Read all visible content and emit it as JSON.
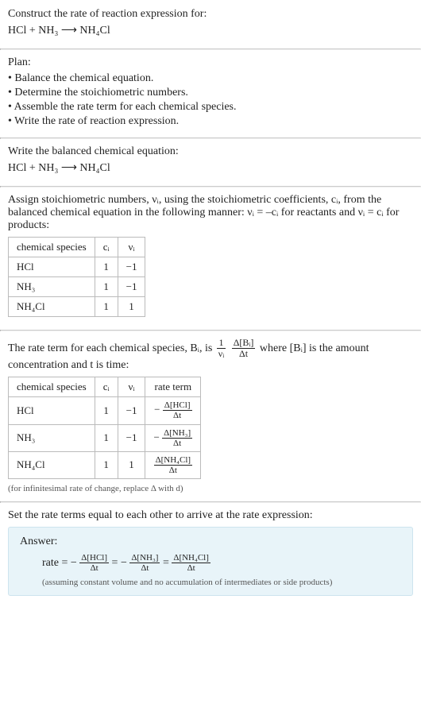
{
  "header": {
    "prompt": "Construct the rate of reaction expression for:",
    "equation": "HCl + NH₃ ⟶ NH₄Cl"
  },
  "plan": {
    "title": "Plan:",
    "items": [
      "• Balance the chemical equation.",
      "• Determine the stoichiometric numbers.",
      "• Assemble the rate term for each chemical species.",
      "• Write the rate of reaction expression."
    ]
  },
  "balanced": {
    "title": "Write the balanced chemical equation:",
    "equation": "HCl + NH₃ ⟶ NH₄Cl"
  },
  "stoich": {
    "intro_a": "Assign stoichiometric numbers, νᵢ, using the stoichiometric coefficients, cᵢ, from the balanced chemical equation in the following manner: νᵢ = –cᵢ for reactants and νᵢ = cᵢ for products:",
    "head": {
      "species": "chemical species",
      "ci": "cᵢ",
      "vi": "νᵢ"
    },
    "rows": [
      {
        "species": "HCl",
        "ci": "1",
        "vi": "−1"
      },
      {
        "species": "NH₃",
        "ci": "1",
        "vi": "−1"
      },
      {
        "species": "NH₄Cl",
        "ci": "1",
        "vi": "1"
      }
    ]
  },
  "rateterm": {
    "intro_pre": "The rate term for each chemical species, Bᵢ, is ",
    "intro_post": " where [Bᵢ] is the amount concentration and t is time:",
    "frac1_num": "1",
    "frac1_den": "νᵢ",
    "frac2_num": "Δ[Bᵢ]",
    "frac2_den": "Δt",
    "head": {
      "species": "chemical species",
      "ci": "cᵢ",
      "vi": "νᵢ",
      "rate": "rate term"
    },
    "rows": [
      {
        "species": "HCl",
        "ci": "1",
        "vi": "−1",
        "sign": "−",
        "num": "Δ[HCl]",
        "den": "Δt"
      },
      {
        "species": "NH₃",
        "ci": "1",
        "vi": "−1",
        "sign": "−",
        "num": "Δ[NH₃]",
        "den": "Δt"
      },
      {
        "species": "NH₄Cl",
        "ci": "1",
        "vi": "1",
        "sign": "",
        "num": "Δ[NH₄Cl]",
        "den": "Δt"
      }
    ],
    "note": "(for infinitesimal rate of change, replace Δ with d)"
  },
  "final": {
    "title": "Set the rate terms equal to each other to arrive at the rate expression:",
    "answer_label": "Answer:",
    "rate_label": "rate = ",
    "eq": " = ",
    "t1": {
      "sign": "−",
      "num": "Δ[HCl]",
      "den": "Δt"
    },
    "t2": {
      "sign": "−",
      "num": "Δ[NH₃]",
      "den": "Δt"
    },
    "t3": {
      "sign": "",
      "num": "Δ[NH₄Cl]",
      "den": "Δt"
    },
    "assumption": "(assuming constant volume and no accumulation of intermediates or side products)"
  },
  "chart_data": {
    "type": "table",
    "tables": [
      {
        "title": "Stoichiometric numbers",
        "columns": [
          "chemical species",
          "cᵢ",
          "νᵢ"
        ],
        "rows": [
          [
            "HCl",
            1,
            -1
          ],
          [
            "NH₃",
            1,
            -1
          ],
          [
            "NH₄Cl",
            1,
            1
          ]
        ]
      },
      {
        "title": "Rate terms",
        "columns": [
          "chemical species",
          "cᵢ",
          "νᵢ",
          "rate term"
        ],
        "rows": [
          [
            "HCl",
            1,
            -1,
            "−Δ[HCl]/Δt"
          ],
          [
            "NH₃",
            1,
            -1,
            "−Δ[NH₃]/Δt"
          ],
          [
            "NH₄Cl",
            1,
            1,
            "Δ[NH₄Cl]/Δt"
          ]
        ]
      }
    ],
    "balanced_equation": "HCl + NH₃ ⟶ NH₄Cl",
    "rate_expression": "rate = −Δ[HCl]/Δt = −Δ[NH₃]/Δt = Δ[NH₄Cl]/Δt"
  }
}
